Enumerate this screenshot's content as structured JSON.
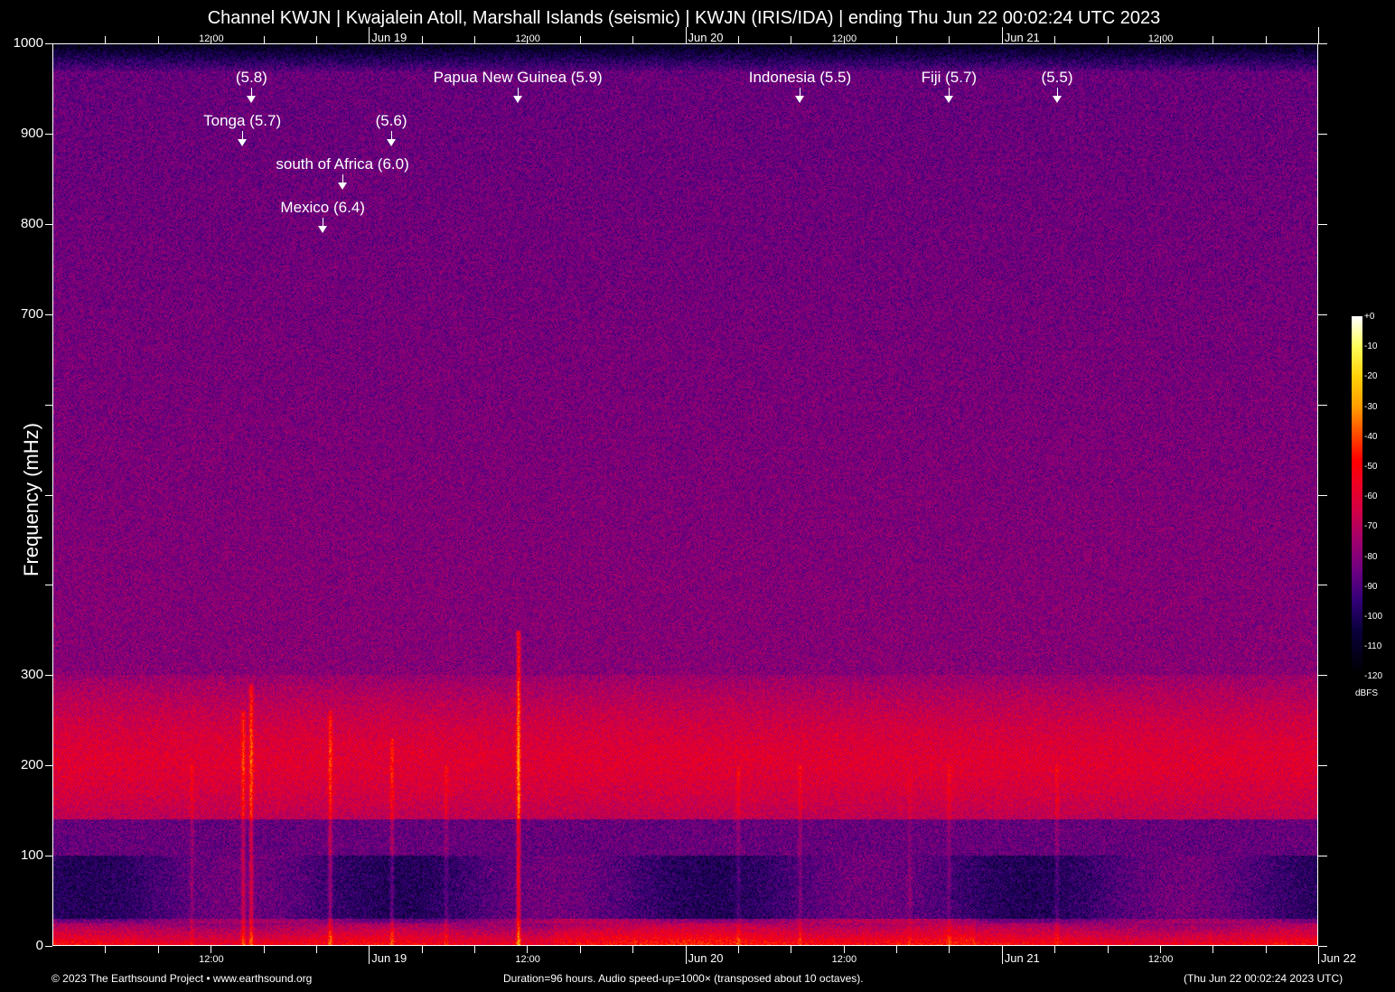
{
  "chart_data": {
    "type": "heatmap",
    "title": "Channel KWJN | Kwajalein Atoll, Marshall Islands (seismic) | KWJN (IRIS/IDA) | ending Thu Jun 22 00:02:24 UTC 2023",
    "ylabel": "Frequency (mHz)",
    "ylim": [
      0,
      1000
    ],
    "yticks": [
      0,
      100,
      200,
      300,
      400,
      500,
      600,
      700,
      800,
      900,
      1000
    ],
    "ytick_labels": [
      "0",
      "100",
      "200",
      "300",
      "",
      "",
      "",
      "700",
      "800",
      "900",
      "1000"
    ],
    "xlim_hours": [
      0,
      96
    ],
    "xtick_labels": [
      {
        "h": 12,
        "label": "12:00"
      },
      {
        "h": 24,
        "label": "Jun 19"
      },
      {
        "h": 36,
        "label": "12:00"
      },
      {
        "h": 48,
        "label": "Jun 20"
      },
      {
        "h": 60,
        "label": "12:00"
      },
      {
        "h": 72,
        "label": "Jun 21"
      },
      {
        "h": 84,
        "label": "12:00"
      },
      {
        "h": 96,
        "label": "Jun 22"
      }
    ],
    "colorbar": {
      "label": "dBFS",
      "range": [
        -120,
        0
      ],
      "ticks": [
        "+0",
        "-10",
        "-20",
        "-30",
        "-40",
        "-50",
        "-60",
        "-70",
        "-80",
        "-90",
        "-100",
        "-110",
        "-120"
      ]
    },
    "events": [
      {
        "label": "(5.8)",
        "h": 15.1,
        "row": 0
      },
      {
        "label": "Tonga (5.7)",
        "h": 14.4,
        "row": 1
      },
      {
        "label": "south of Africa (6.0)",
        "h": 22.0,
        "row": 2
      },
      {
        "label": "Mexico (6.4)",
        "h": 20.5,
        "row": 3
      },
      {
        "label": "(5.6)",
        "h": 25.7,
        "row": 1
      },
      {
        "label": "Papua New Guinea (5.9)",
        "h": 35.3,
        "row": 0
      },
      {
        "label": "Indonesia (5.5)",
        "h": 56.7,
        "row": 0
      },
      {
        "label": "Fiji (5.7)",
        "h": 68.0,
        "row": 0
      },
      {
        "label": "(5.5)",
        "h": 76.2,
        "row": 0
      }
    ]
  },
  "footer": {
    "left": "© 2023 The Earthsound Project • www.earthsound.org",
    "center": "Duration=96 hours. Audio speed-up=1000× (transposed about 10 octaves).",
    "right": "(Thu Jun 22 00:02:24 2023 UTC)"
  }
}
